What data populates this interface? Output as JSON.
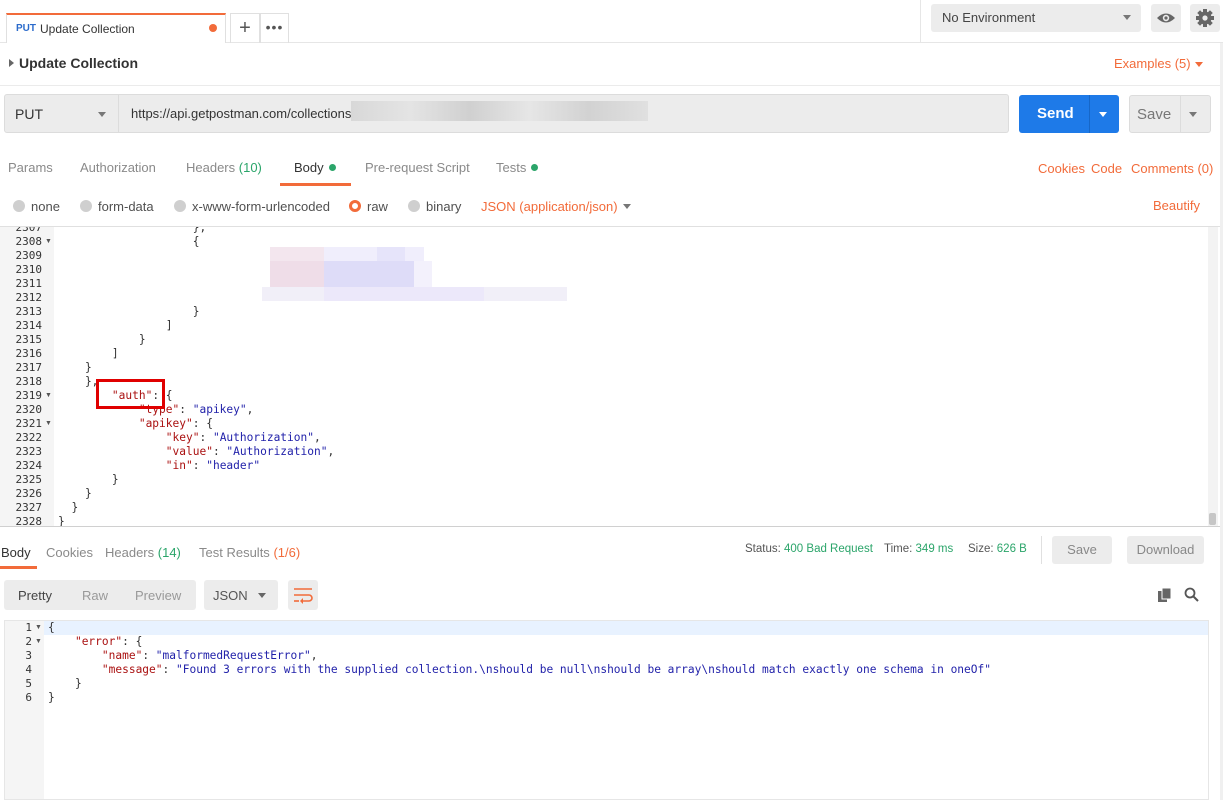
{
  "tabs": [
    {
      "method": "PUT",
      "name": "Update Collection",
      "unsaved": true
    }
  ],
  "tab_actions": {
    "add": "+",
    "more": "•••"
  },
  "environment": {
    "selected": "No Environment"
  },
  "request": {
    "title": "Update Collection",
    "examples": "Examples (5)",
    "method": "PUT",
    "url": "https://api.getpostman.com/collections",
    "send_label": "Send",
    "save_label": "Save"
  },
  "request_tabs": [
    {
      "label": "Params",
      "count": ""
    },
    {
      "label": "Authorization",
      "count": ""
    },
    {
      "label": "Headers",
      "count": "(10)"
    },
    {
      "label": "Body",
      "count": ""
    },
    {
      "label": "Pre-request Script",
      "count": ""
    },
    {
      "label": "Tests",
      "count": ""
    }
  ],
  "request_links": {
    "cookies": "Cookies",
    "code": "Code",
    "comments": "Comments (0)"
  },
  "body_types": {
    "options": [
      "none",
      "form-data",
      "x-www-form-urlencoded",
      "raw",
      "binary"
    ],
    "selected": "raw",
    "content_type": "JSON (application/json)",
    "beautify": "Beautify"
  },
  "request_body_lines": [
    {
      "n": "2307",
      "t": "                    },"
    },
    {
      "n": "2308",
      "t": "                    {"
    },
    {
      "n": "2309",
      "t": ""
    },
    {
      "n": "2310",
      "t": ""
    },
    {
      "n": "2311",
      "t": ""
    },
    {
      "n": "2312",
      "t": ""
    },
    {
      "n": "2313",
      "t": "                    }"
    },
    {
      "n": "2314",
      "t": "                ]"
    },
    {
      "n": "2315",
      "t": "            }"
    },
    {
      "n": "2316",
      "t": "        ]"
    },
    {
      "n": "2317",
      "t": "    }"
    },
    {
      "n": "2318",
      "t": "    },"
    },
    {
      "n": "2319",
      "k": "\"auth\"",
      "r": ": {"
    },
    {
      "n": "2320",
      "k": "\"type\"",
      "r": ": ",
      "s": "\"apikey\"",
      "e": ","
    },
    {
      "n": "2321",
      "k": "\"apikey\"",
      "r": ": {"
    },
    {
      "n": "2322",
      "k": "\"key\"",
      "r": ": ",
      "s": "\"Authorization\"",
      "e": ","
    },
    {
      "n": "2323",
      "k": "\"value\"",
      "r": ": ",
      "s": "\"Authorization\"",
      "e": ","
    },
    {
      "n": "2324",
      "k": "\"in\"",
      "r": ": ",
      "s": "\"header\"",
      "e": ""
    },
    {
      "n": "2325",
      "t": "        }"
    },
    {
      "n": "2326",
      "t": "    }"
    },
    {
      "n": "2327",
      "t": "  }"
    },
    {
      "n": "2328",
      "t": "}"
    }
  ],
  "response": {
    "tabs": [
      {
        "label": "Body",
        "count": ""
      },
      {
        "label": "Cookies",
        "count": ""
      },
      {
        "label": "Headers",
        "count": "(14)"
      },
      {
        "label": "Test Results",
        "count": "(1/6)"
      }
    ],
    "status_label": "Status:",
    "status_value": "400 Bad Request",
    "time_label": "Time:",
    "time_value": "349 ms",
    "size_label": "Size:",
    "size_value": "626 B",
    "save_label": "Save",
    "download_label": "Download",
    "views": [
      "Pretty",
      "Raw",
      "Preview"
    ],
    "format": "JSON",
    "lines": [
      {
        "n": "1",
        "t": "{"
      },
      {
        "n": "2",
        "k": "\"error\"",
        "r": ": {"
      },
      {
        "n": "3",
        "k": "\"name\"",
        "r": ": ",
        "s": "\"malformedRequestError\"",
        "e": ","
      },
      {
        "n": "4",
        "k": "\"message\"",
        "r": ": ",
        "s": "\"Found 3 errors with the supplied collection.\\nshould be null\\nshould be array\\nshould match exactly one schema in oneOf\"",
        "e": ""
      },
      {
        "n": "5",
        "t": "    }"
      },
      {
        "n": "6",
        "t": "}"
      }
    ]
  },
  "colors": {
    "accent": "#f26b3a",
    "send": "#1e7ae8",
    "status_green": "#2ba56a",
    "highlight": "#e00000"
  }
}
